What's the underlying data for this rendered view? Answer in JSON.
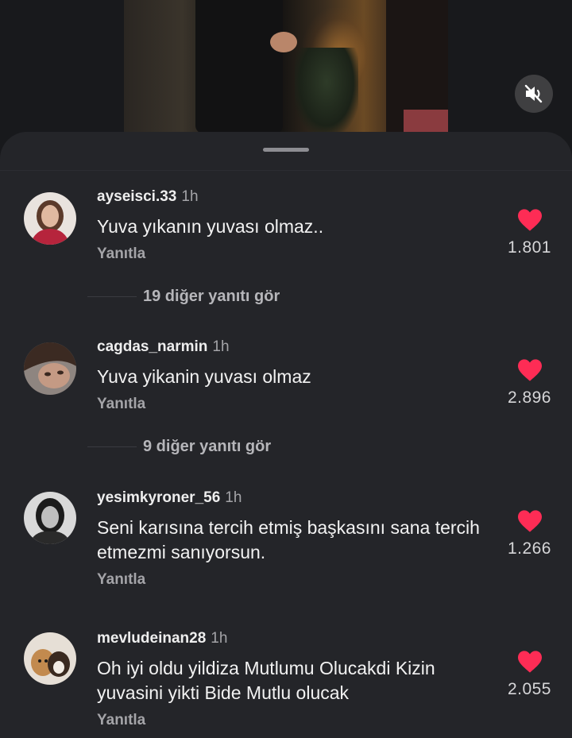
{
  "video": {
    "mute_icon": "speaker-muted-icon"
  },
  "comments": [
    {
      "username": "ayseisci.33",
      "time": "1h",
      "text": "Yuva yıkanın yuvası olmaz..",
      "reply_label": "Yanıtla",
      "likes": "1.801",
      "more_replies": "19 diğer yanıtı gör"
    },
    {
      "username": "cagdas_narmin",
      "time": "1h",
      "text": "Yuva yikanin yuvası olmaz",
      "reply_label": "Yanıtla",
      "likes": "2.896",
      "more_replies": "9 diğer yanıtı gör"
    },
    {
      "username": "yesimkyroner_56",
      "time": "1h",
      "text": "Seni karısına tercih etmiş başkasını sana tercih etmezmi sanıyorsun.",
      "reply_label": "Yanıtla",
      "likes": "1.266"
    },
    {
      "username": "mevludeinan28",
      "time": "1h",
      "text": "Oh iyi oldu  yildiza Mutlumu Olucakdi Kizin yuvasini yikti Bide Mutlu  olucak",
      "reply_label": "Yanıtla",
      "likes": "2.055"
    }
  ],
  "colors": {
    "heart": "#fe2c55",
    "sheet_bg": "#242529"
  }
}
